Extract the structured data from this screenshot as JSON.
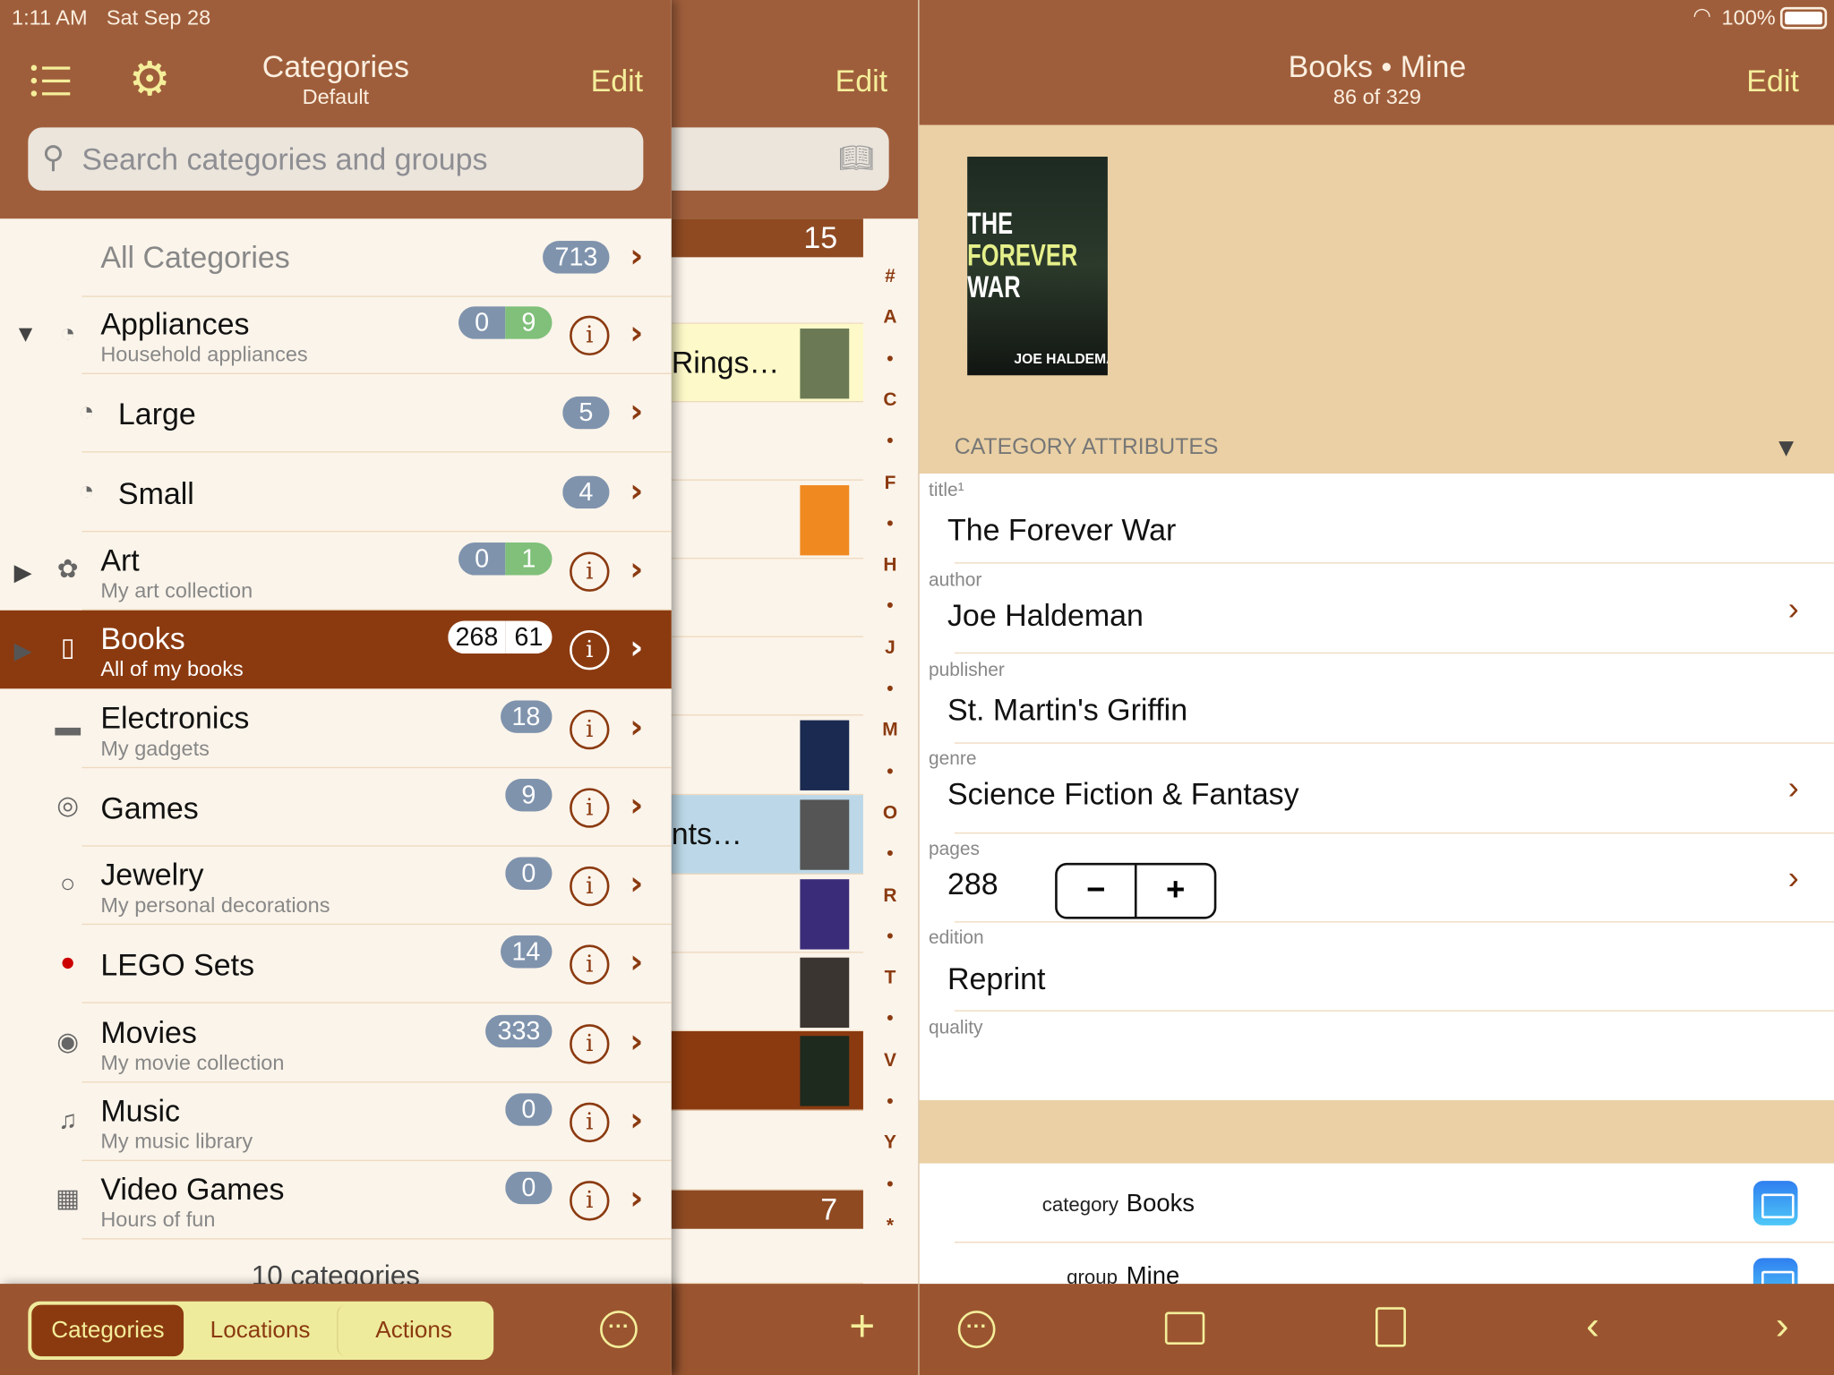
{
  "status": {
    "time": "1:11 AM",
    "date": "Sat Sep 28",
    "battery": "100%",
    "wifi_icon": "wifi-icon",
    "battery_icon": "battery-icon"
  },
  "colors": {
    "header": "#9f5e3b",
    "toolbar": "#9a5530",
    "accent": "#8b3a10",
    "edit": "#f4ee9a",
    "badge": "#7f93ad",
    "badge_green": "#80c07a",
    "tan": "#ead0a4"
  },
  "left": {
    "title": "Categories",
    "subtitle": "Default",
    "edit": "Edit",
    "search_placeholder": "Search categories and groups",
    "all": {
      "label": "All Categories",
      "count": "713"
    },
    "rows": [
      {
        "name": "Appliances",
        "sub": "Household appliances",
        "icon": "◔",
        "expand": "▼",
        "badges": [
          "0",
          "9"
        ],
        "info": true,
        "indent": false
      },
      {
        "name": "Large",
        "sub": "",
        "icon": "◔",
        "expand": "",
        "badges": [
          "5"
        ],
        "info": false,
        "indent": true
      },
      {
        "name": "Small",
        "sub": "",
        "icon": "◔",
        "expand": "",
        "badges": [
          "4"
        ],
        "info": false,
        "indent": true
      },
      {
        "name": "Art",
        "sub": "My art collection",
        "icon": "✿",
        "expand": "▶",
        "badges": [
          "0",
          "1"
        ],
        "info": true,
        "indent": false
      },
      {
        "name": "Books",
        "sub": "All of my books",
        "icon": "▯",
        "expand": "▶",
        "badges": [
          "268",
          "61"
        ],
        "info": true,
        "indent": false,
        "selected": true
      },
      {
        "name": "Electronics",
        "sub": "My gadgets",
        "icon": "▬",
        "expand": "",
        "badges": [
          "18"
        ],
        "info": true,
        "indent": false
      },
      {
        "name": "Games",
        "sub": "",
        "icon": "◎",
        "expand": "",
        "badges": [
          "9"
        ],
        "info": true,
        "indent": false
      },
      {
        "name": "Jewelry",
        "sub": "My personal decorations",
        "icon": "○",
        "expand": "",
        "badges": [
          "0"
        ],
        "info": true,
        "indent": false
      },
      {
        "name": "LEGO Sets",
        "sub": "",
        "icon": "●",
        "expand": "",
        "badges": [
          "14"
        ],
        "info": true,
        "indent": false
      },
      {
        "name": "Movies",
        "sub": "My movie collection",
        "icon": "◉",
        "expand": "",
        "badges": [
          "333"
        ],
        "info": true,
        "indent": false
      },
      {
        "name": "Music",
        "sub": "My music library",
        "icon": "♫",
        "expand": "",
        "badges": [
          "0"
        ],
        "info": true,
        "indent": false
      },
      {
        "name": "Video Games",
        "sub": "Hours of fun",
        "icon": "▦",
        "expand": "",
        "badges": [
          "0"
        ],
        "info": true,
        "indent": false
      }
    ],
    "footer": "10 categories",
    "segments": [
      "Categories",
      "Locations",
      "Actions"
    ],
    "selected_segment": "Categories"
  },
  "middle": {
    "edit": "Edit",
    "section_counts": [
      "15",
      "7"
    ],
    "visible_titles": [
      "Rings…",
      "nts…"
    ],
    "index": [
      "#",
      "A",
      "•",
      "C",
      "•",
      "F",
      "•",
      "H",
      "•",
      "J",
      "•",
      "M",
      "•",
      "O",
      "•",
      "R",
      "•",
      "T",
      "•",
      "V",
      "•",
      "Y",
      "•",
      "*"
    ]
  },
  "right": {
    "title": "Books • Mine",
    "subtitle": "86 of 329",
    "edit": "Edit",
    "cover": {
      "title_line1": "THE",
      "title_line2": "FOREVER",
      "title_line3": "WAR",
      "author": "JOE HALDEMAN"
    },
    "section": "CATEGORY ATTRIBUTES",
    "fields": {
      "title": {
        "label": "title¹",
        "value": "The Forever War"
      },
      "author": {
        "label": "author",
        "value": "Joe Haldeman"
      },
      "publisher": {
        "label": "publisher",
        "value": "St. Martin's Griffin"
      },
      "genre": {
        "label": "genre",
        "value": "Science Fiction & Fantasy"
      },
      "pages": {
        "label": "pages",
        "value": "288",
        "minus": "−",
        "plus": "+"
      },
      "edition": {
        "label": "edition",
        "value": "Reprint"
      },
      "quality": {
        "label": "quality",
        "value": ""
      }
    },
    "category": {
      "label": "category",
      "value": "Books"
    },
    "group": {
      "label": "group",
      "value": "Mine"
    }
  }
}
